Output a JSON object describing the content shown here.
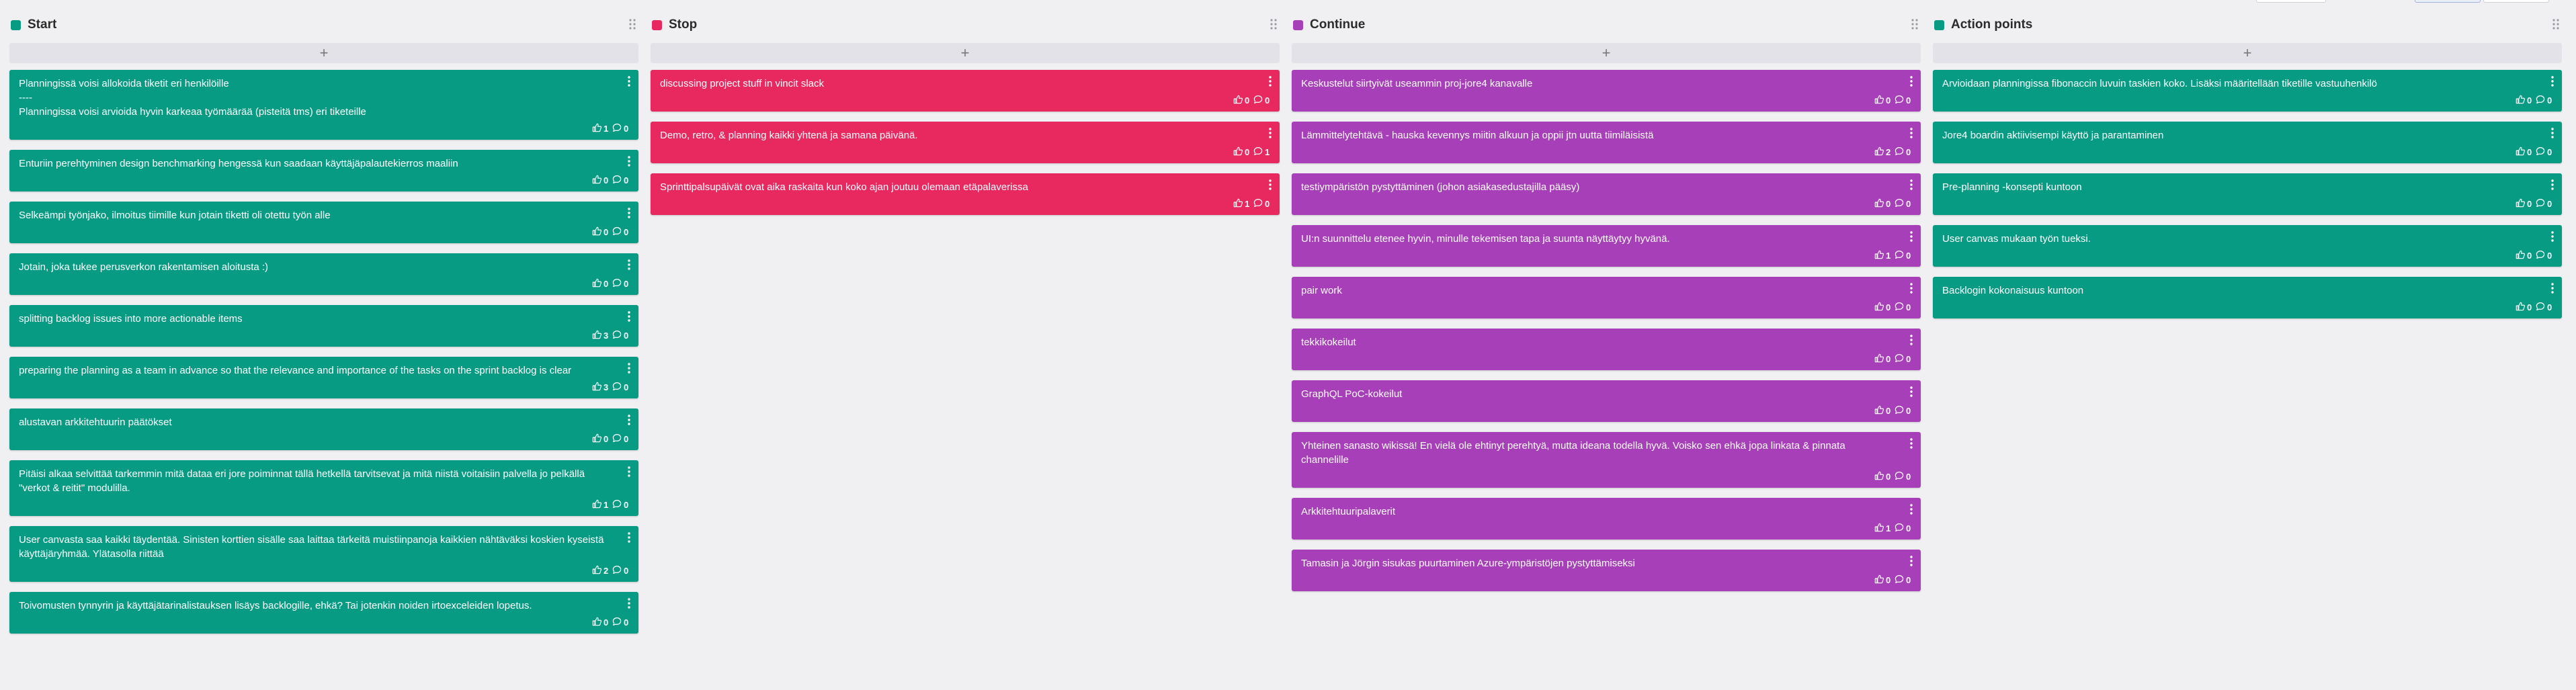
{
  "columns": [
    {
      "title": "Start",
      "color": "#079b83",
      "add_label": "+",
      "cards": [
        {
          "text": "Planningissä voisi allokoida tiketit eri henkilöille\n----\nPlanningissa voisi arvioida hyvin karkeaa työmäärää (pisteitä tms) eri tiketeille",
          "likes": "1",
          "comments": "0"
        },
        {
          "text": "Enturiin perehtyminen design benchmarking hengessä kun saadaan käyttäjäpalautekierros maaliin",
          "likes": "0",
          "comments": "0"
        },
        {
          "text": "Selkeämpi työnjako, ilmoitus tiimille kun jotain tiketti oli otettu työn alle",
          "likes": "0",
          "comments": "0"
        },
        {
          "text": "Jotain, joka tukee perusverkon rakentamisen aloitusta :)",
          "likes": "0",
          "comments": "0"
        },
        {
          "text": "splitting backlog issues into more actionable items",
          "likes": "3",
          "comments": "0"
        },
        {
          "text": "preparing the planning as a team in advance so that the relevance and importance of the tasks on the sprint backlog is clear",
          "likes": "3",
          "comments": "0"
        },
        {
          "text": "alustavan arkkitehtuurin päätökset",
          "likes": "0",
          "comments": "0"
        },
        {
          "text": "Pitäisi alkaa selvittää tarkemmin mitä dataa eri jore poiminnat tällä hetkellä tarvitsevat ja mitä niistä voitaisiin palvella jo pelkällä \"verkot & reitit\" modulilla.",
          "likes": "1",
          "comments": "0"
        },
        {
          "text": "User canvasta saa kaikki täydentää. Sinisten korttien sisälle saa laittaa tärkeitä muistiinpanoja kaikkien nähtäväksi koskien kyseistä käyttäjäryhmää. Ylätasolla riittää",
          "likes": "2",
          "comments": "0"
        },
        {
          "text": "Toivomusten tynnyrin ja käyttäjätarinalistauksen lisäys backlogille, ehkä? Tai jotenkin noiden irtoexceleiden lopetus.",
          "likes": "0",
          "comments": "0"
        }
      ]
    },
    {
      "title": "Stop",
      "color": "#e8295f",
      "add_label": "+",
      "cards": [
        {
          "text": "discussing project stuff in vincit slack",
          "likes": "0",
          "comments": "0"
        },
        {
          "text": "Demo, retro, & planning kaikki yhtenä ja samana päivänä.",
          "likes": "0",
          "comments": "1"
        },
        {
          "text": "Sprinttipalsupäivät ovat aika raskaita kun koko ajan joutuu olemaan etäpalaverissa",
          "likes": "1",
          "comments": "0"
        }
      ]
    },
    {
      "title": "Continue",
      "color": "#a73fb9",
      "add_label": "+",
      "cards": [
        {
          "text": "Keskustelut siirtyivät useammin proj-jore4 kanavalle",
          "likes": "0",
          "comments": "0"
        },
        {
          "text": "Lämmittelytehtävä - hauska kevennys miitin alkuun ja oppii jtn uutta tiimiläisistä",
          "likes": "2",
          "comments": "0"
        },
        {
          "text": "testiympäristön pystyttäminen (johon asiakasedustajilla pääsy)",
          "likes": "0",
          "comments": "0"
        },
        {
          "text": "UI:n suunnittelu etenee hyvin, minulle tekemisen tapa ja suunta näyttäytyy hyvänä.",
          "likes": "1",
          "comments": "0"
        },
        {
          "text": "pair work",
          "likes": "0",
          "comments": "0"
        },
        {
          "text": "tekkikokeilut",
          "likes": "0",
          "comments": "0"
        },
        {
          "text": "GraphQL PoC-kokeilut",
          "likes": "0",
          "comments": "0"
        },
        {
          "text": "Yhteinen sanasto wikissä! En vielä ole ehtinyt perehtyä, mutta ideana todella hyvä. Voisko sen ehkä jopa linkata & pinnata channelille",
          "likes": "0",
          "comments": "0"
        },
        {
          "text": "Arkkitehtuuripalaverit",
          "likes": "1",
          "comments": "0"
        },
        {
          "text": "Tamasin ja Jörgin sisukas puurtaminen Azure-ympäristöjen pystyttämiseksi",
          "likes": "0",
          "comments": "0"
        }
      ]
    },
    {
      "title": "Action points",
      "color": "#079b83",
      "add_label": "+",
      "cards": [
        {
          "text": "Arvioidaan planningissa fibonaccin luvuin taskien koko. Lisäksi määritellään tiketille vastuuhenkilö",
          "likes": "0",
          "comments": "0"
        },
        {
          "text": "Jore4 boardin aktiivisempi käyttö ja parantaminen",
          "likes": "0",
          "comments": "0"
        },
        {
          "text": "Pre-planning -konsepti kuntoon",
          "likes": "0",
          "comments": "0"
        },
        {
          "text": "User canvas mukaan työn tueksi.",
          "likes": "0",
          "comments": "0"
        },
        {
          "text": "Backlogin kokonaisuus kuntoon",
          "likes": "0",
          "comments": "0"
        }
      ]
    }
  ]
}
